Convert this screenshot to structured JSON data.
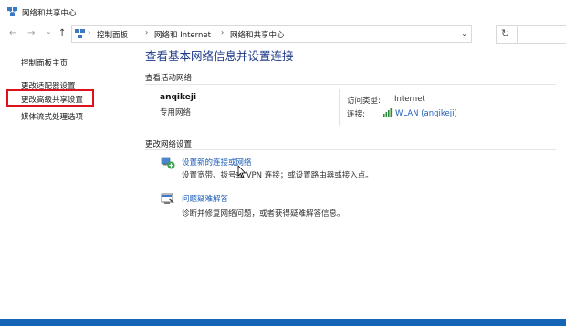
{
  "window": {
    "title": "网络和共享中心"
  },
  "nav": {
    "back": "←",
    "forward": "→",
    "dropdown": "⌄",
    "up": "↑",
    "refresh": "↻"
  },
  "address": {
    "crumbs": [
      "控制面板",
      "网络和 Internet",
      "网络和共享中心"
    ],
    "separator": "›"
  },
  "sidebar": {
    "items": [
      {
        "label": "控制面板主页"
      },
      {
        "label": "更改适配器设置"
      },
      {
        "label": "更改高级共享设置",
        "highlighted": true
      },
      {
        "label": "媒体流式处理选项"
      }
    ],
    "highlight_color": "#e0101c"
  },
  "main": {
    "title": "查看基本网络信息并设置连接",
    "active_networks_label": "查看活动网络",
    "network": {
      "name": "anqikeji",
      "type": "专用网络",
      "access_type_label": "访问类型:",
      "access_type_value": "Internet",
      "connection_label": "连接:",
      "connection_value": "WLAN (anqikeji)"
    },
    "change_settings_label": "更改网络设置",
    "tasks": [
      {
        "icon": "network-setup-icon",
        "link": "设置新的连接或网络",
        "description": "设置宽带、拨号或 VPN 连接；或设置路由器或接入点。"
      },
      {
        "icon": "troubleshoot-icon",
        "link": "问题疑难解答",
        "description": "诊断并修复网络问题，或者获得疑难解答信息。"
      }
    ]
  },
  "colors": {
    "title_blue": "#1d3a8a",
    "link_blue": "#1f5fb8",
    "taskbar_blue": "#1565b6"
  }
}
